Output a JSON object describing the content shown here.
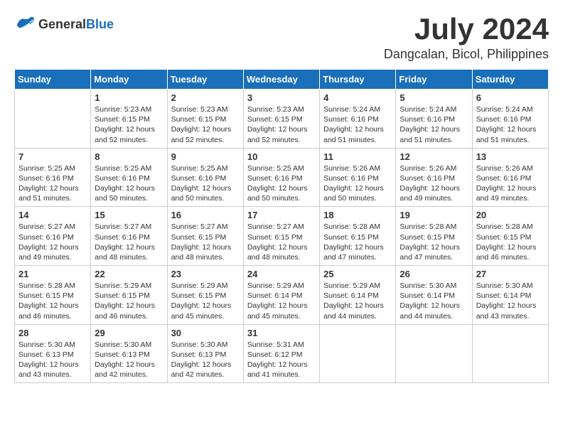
{
  "header": {
    "logo": {
      "general": "General",
      "blue": "Blue"
    },
    "title": "July 2024",
    "location": "Dangcalan, Bicol, Philippines"
  },
  "calendar": {
    "days_of_week": [
      "Sunday",
      "Monday",
      "Tuesday",
      "Wednesday",
      "Thursday",
      "Friday",
      "Saturday"
    ],
    "weeks": [
      [
        {
          "day": "",
          "sunrise": "",
          "sunset": "",
          "daylight": ""
        },
        {
          "day": "1",
          "sunrise": "Sunrise: 5:23 AM",
          "sunset": "Sunset: 6:15 PM",
          "daylight": "Daylight: 12 hours and 52 minutes."
        },
        {
          "day": "2",
          "sunrise": "Sunrise: 5:23 AM",
          "sunset": "Sunset: 6:15 PM",
          "daylight": "Daylight: 12 hours and 52 minutes."
        },
        {
          "day": "3",
          "sunrise": "Sunrise: 5:23 AM",
          "sunset": "Sunset: 6:15 PM",
          "daylight": "Daylight: 12 hours and 52 minutes."
        },
        {
          "day": "4",
          "sunrise": "Sunrise: 5:24 AM",
          "sunset": "Sunset: 6:16 PM",
          "daylight": "Daylight: 12 hours and 51 minutes."
        },
        {
          "day": "5",
          "sunrise": "Sunrise: 5:24 AM",
          "sunset": "Sunset: 6:16 PM",
          "daylight": "Daylight: 12 hours and 51 minutes."
        },
        {
          "day": "6",
          "sunrise": "Sunrise: 5:24 AM",
          "sunset": "Sunset: 6:16 PM",
          "daylight": "Daylight: 12 hours and 51 minutes."
        }
      ],
      [
        {
          "day": "7",
          "sunrise": "Sunrise: 5:25 AM",
          "sunset": "Sunset: 6:16 PM",
          "daylight": "Daylight: 12 hours and 51 minutes."
        },
        {
          "day": "8",
          "sunrise": "Sunrise: 5:25 AM",
          "sunset": "Sunset: 6:16 PM",
          "daylight": "Daylight: 12 hours and 50 minutes."
        },
        {
          "day": "9",
          "sunrise": "Sunrise: 5:25 AM",
          "sunset": "Sunset: 6:16 PM",
          "daylight": "Daylight: 12 hours and 50 minutes."
        },
        {
          "day": "10",
          "sunrise": "Sunrise: 5:25 AM",
          "sunset": "Sunset: 6:16 PM",
          "daylight": "Daylight: 12 hours and 50 minutes."
        },
        {
          "day": "11",
          "sunrise": "Sunrise: 5:26 AM",
          "sunset": "Sunset: 6:16 PM",
          "daylight": "Daylight: 12 hours and 50 minutes."
        },
        {
          "day": "12",
          "sunrise": "Sunrise: 5:26 AM",
          "sunset": "Sunset: 6:16 PM",
          "daylight": "Daylight: 12 hours and 49 minutes."
        },
        {
          "day": "13",
          "sunrise": "Sunrise: 5:26 AM",
          "sunset": "Sunset: 6:16 PM",
          "daylight": "Daylight: 12 hours and 49 minutes."
        }
      ],
      [
        {
          "day": "14",
          "sunrise": "Sunrise: 5:27 AM",
          "sunset": "Sunset: 6:16 PM",
          "daylight": "Daylight: 12 hours and 49 minutes."
        },
        {
          "day": "15",
          "sunrise": "Sunrise: 5:27 AM",
          "sunset": "Sunset: 6:16 PM",
          "daylight": "Daylight: 12 hours and 48 minutes."
        },
        {
          "day": "16",
          "sunrise": "Sunrise: 5:27 AM",
          "sunset": "Sunset: 6:15 PM",
          "daylight": "Daylight: 12 hours and 48 minutes."
        },
        {
          "day": "17",
          "sunrise": "Sunrise: 5:27 AM",
          "sunset": "Sunset: 6:15 PM",
          "daylight": "Daylight: 12 hours and 48 minutes."
        },
        {
          "day": "18",
          "sunrise": "Sunrise: 5:28 AM",
          "sunset": "Sunset: 6:15 PM",
          "daylight": "Daylight: 12 hours and 47 minutes."
        },
        {
          "day": "19",
          "sunrise": "Sunrise: 5:28 AM",
          "sunset": "Sunset: 6:15 PM",
          "daylight": "Daylight: 12 hours and 47 minutes."
        },
        {
          "day": "20",
          "sunrise": "Sunrise: 5:28 AM",
          "sunset": "Sunset: 6:15 PM",
          "daylight": "Daylight: 12 hours and 46 minutes."
        }
      ],
      [
        {
          "day": "21",
          "sunrise": "Sunrise: 5:28 AM",
          "sunset": "Sunset: 6:15 PM",
          "daylight": "Daylight: 12 hours and 46 minutes."
        },
        {
          "day": "22",
          "sunrise": "Sunrise: 5:29 AM",
          "sunset": "Sunset: 6:15 PM",
          "daylight": "Daylight: 12 hours and 46 minutes."
        },
        {
          "day": "23",
          "sunrise": "Sunrise: 5:29 AM",
          "sunset": "Sunset: 6:15 PM",
          "daylight": "Daylight: 12 hours and 45 minutes."
        },
        {
          "day": "24",
          "sunrise": "Sunrise: 5:29 AM",
          "sunset": "Sunset: 6:14 PM",
          "daylight": "Daylight: 12 hours and 45 minutes."
        },
        {
          "day": "25",
          "sunrise": "Sunrise: 5:29 AM",
          "sunset": "Sunset: 6:14 PM",
          "daylight": "Daylight: 12 hours and 44 minutes."
        },
        {
          "day": "26",
          "sunrise": "Sunrise: 5:30 AM",
          "sunset": "Sunset: 6:14 PM",
          "daylight": "Daylight: 12 hours and 44 minutes."
        },
        {
          "day": "27",
          "sunrise": "Sunrise: 5:30 AM",
          "sunset": "Sunset: 6:14 PM",
          "daylight": "Daylight: 12 hours and 43 minutes."
        }
      ],
      [
        {
          "day": "28",
          "sunrise": "Sunrise: 5:30 AM",
          "sunset": "Sunset: 6:13 PM",
          "daylight": "Daylight: 12 hours and 43 minutes."
        },
        {
          "day": "29",
          "sunrise": "Sunrise: 5:30 AM",
          "sunset": "Sunset: 6:13 PM",
          "daylight": "Daylight: 12 hours and 42 minutes."
        },
        {
          "day": "30",
          "sunrise": "Sunrise: 5:30 AM",
          "sunset": "Sunset: 6:13 PM",
          "daylight": "Daylight: 12 hours and 42 minutes."
        },
        {
          "day": "31",
          "sunrise": "Sunrise: 5:31 AM",
          "sunset": "Sunset: 6:12 PM",
          "daylight": "Daylight: 12 hours and 41 minutes."
        },
        {
          "day": "",
          "sunrise": "",
          "sunset": "",
          "daylight": ""
        },
        {
          "day": "",
          "sunrise": "",
          "sunset": "",
          "daylight": ""
        },
        {
          "day": "",
          "sunrise": "",
          "sunset": "",
          "daylight": ""
        }
      ]
    ]
  }
}
